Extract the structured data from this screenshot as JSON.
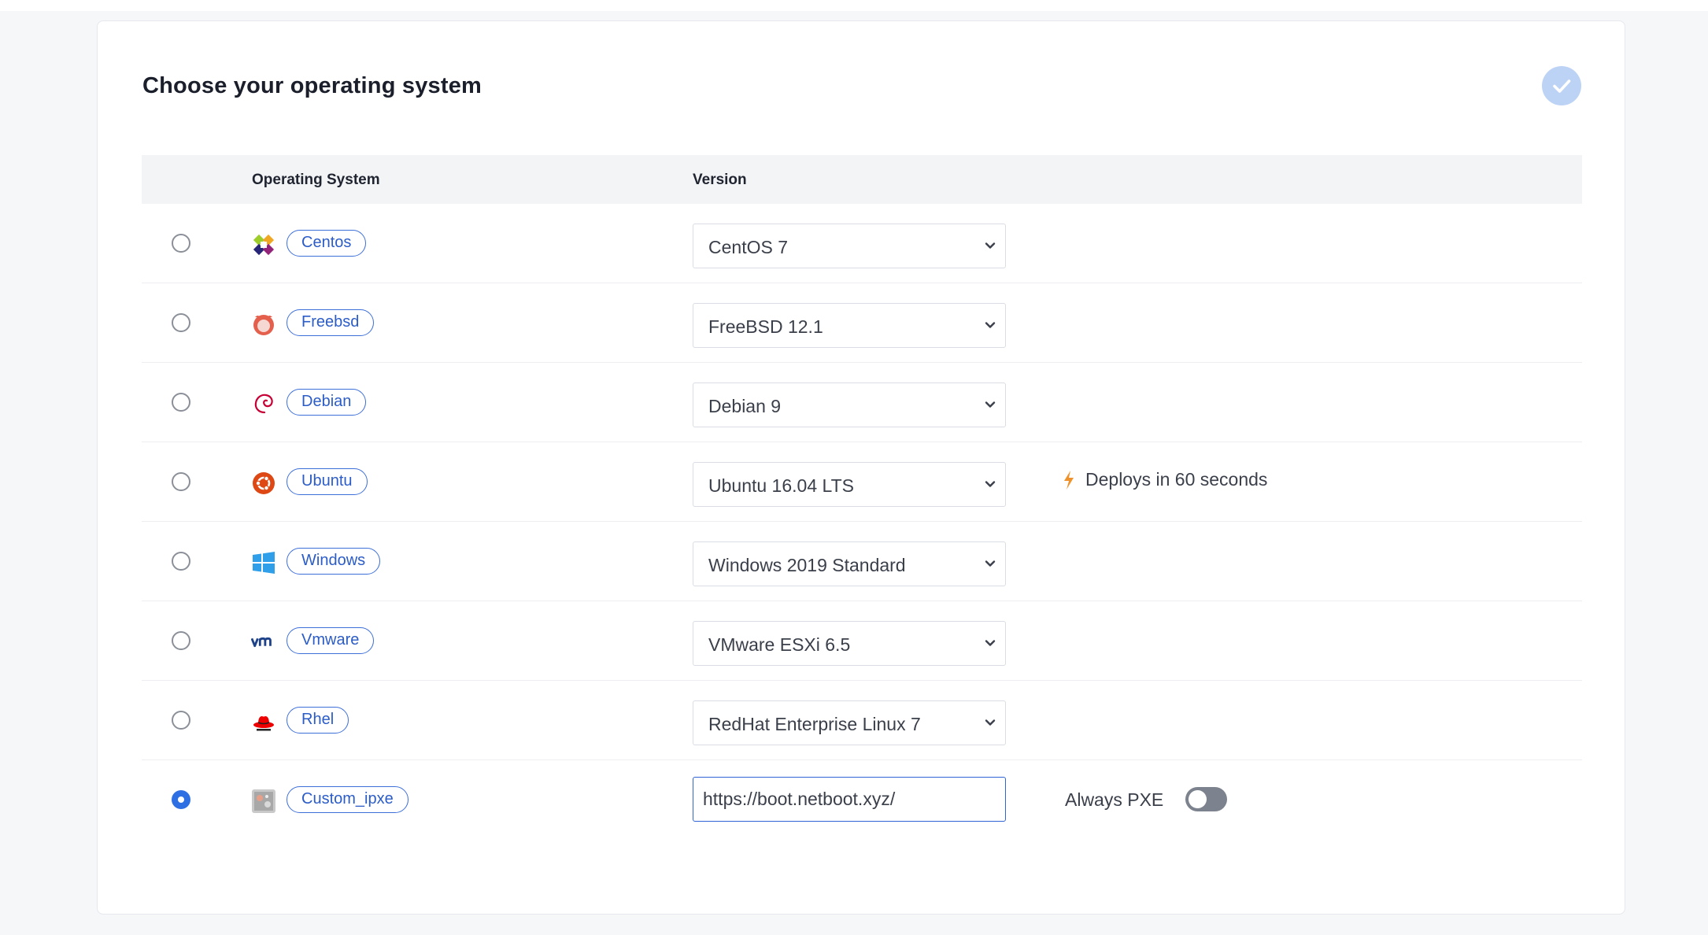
{
  "page": {
    "title": "Choose your operating system",
    "step_complete_icon": "check-circle-icon"
  },
  "table": {
    "columns": [
      "",
      "Operating System",
      "Version"
    ],
    "rows": [
      {
        "os": "Centos",
        "icon": "centos-logo-icon",
        "version": "CentOS 7",
        "selected": false
      },
      {
        "os": "Freebsd",
        "icon": "freebsd-logo-icon",
        "version": "FreeBSD 12.1",
        "selected": false
      },
      {
        "os": "Debian",
        "icon": "debian-logo-icon",
        "version": "Debian 9",
        "selected": false
      },
      {
        "os": "Ubuntu",
        "icon": "ubuntu-logo-icon",
        "version": "Ubuntu 16.04 LTS",
        "selected": false,
        "note": "Deploys in 60 seconds",
        "note_icon": "lightning-bolt-icon"
      },
      {
        "os": "Windows",
        "icon": "windows-logo-icon",
        "version": "Windows 2019 Standard",
        "selected": false
      },
      {
        "os": "Vmware",
        "icon": "vmware-logo-icon",
        "version": "VMware ESXi 6.5",
        "selected": false
      },
      {
        "os": "Rhel",
        "icon": "redhat-logo-icon",
        "version": "RedHat Enterprise Linux 7",
        "selected": false
      },
      {
        "os": "Custom_ipxe",
        "icon": "custom-ipxe-icon",
        "url_value": "https://boot.netboot.xyz/",
        "selected": true,
        "option_label": "Always PXE",
        "option_enabled": false
      }
    ]
  },
  "colors": {
    "accent": "#2f6fe4",
    "tag_border": "#3d6fd9",
    "badge_bg": "#bcd3f6",
    "bolt": "#f0922b",
    "toggle_off": "#7d838e"
  }
}
